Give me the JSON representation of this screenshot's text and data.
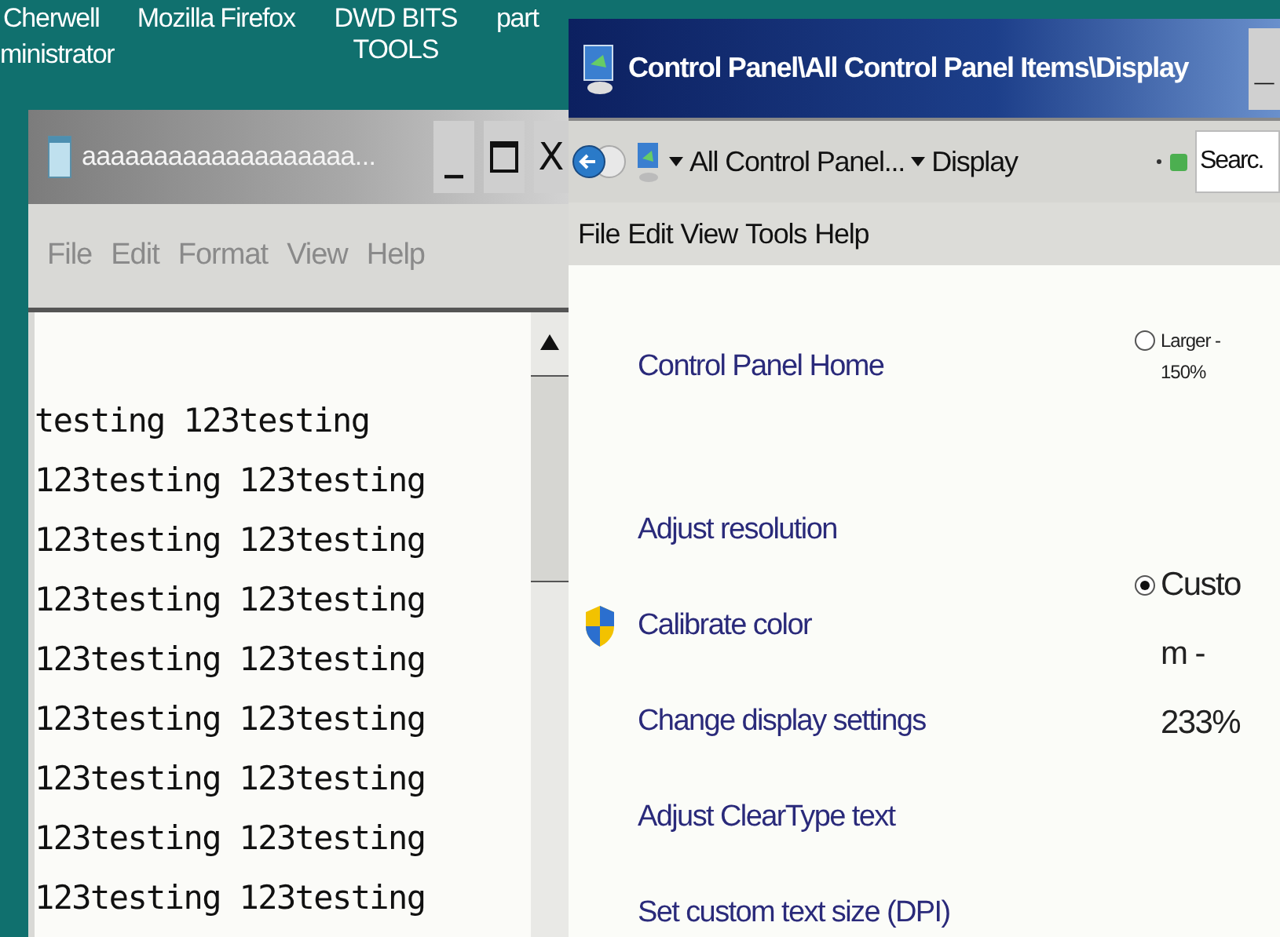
{
  "desktop": {
    "labels": [
      {
        "text": "Cherwell"
      },
      {
        "text": "Mozilla Firefox"
      },
      {
        "text": "DWD BITS TOOLS"
      },
      {
        "text": "part"
      }
    ],
    "partial_label": "ministrator"
  },
  "notepad": {
    "title": "aaaaaaaaaaaaaaaaaaa...",
    "minimize": "_",
    "close": "X",
    "menu": [
      "File",
      "Edit",
      "Format",
      "View",
      "Help"
    ],
    "lines": [
      "testing 123testing",
      "123testing 123testing",
      "123testing 123testing",
      "123testing 123testing",
      "123testing 123testing",
      "123testing 123testing",
      "123testing 123testing",
      "123testing 123testing",
      "123testing 123testing"
    ]
  },
  "control_panel": {
    "title": "Control Panel\\All Control Panel Items\\Display",
    "minimize": "_",
    "breadcrumbs": [
      "All Control Panel...",
      "Display"
    ],
    "search": {
      "placeholder": "Searc."
    },
    "menu": [
      "File",
      "Edit",
      "View",
      "Tools",
      "Help"
    ],
    "links": [
      {
        "text": "Control Panel Home",
        "kind": "home"
      },
      {
        "text": "Adjust resolution",
        "kind": "plain"
      },
      {
        "text": "Calibrate color",
        "kind": "shield"
      },
      {
        "text": "Change display settings",
        "kind": "plain"
      },
      {
        "text": "Adjust ClearType text",
        "kind": "plain"
      },
      {
        "text": "Set custom text size (DPI)",
        "kind": "plain"
      }
    ],
    "options": [
      {
        "label": "Larger - 150%",
        "selected": false,
        "kind": "small"
      },
      {
        "label": "Custom - 233%",
        "selected": true,
        "kind": "large"
      }
    ]
  }
}
